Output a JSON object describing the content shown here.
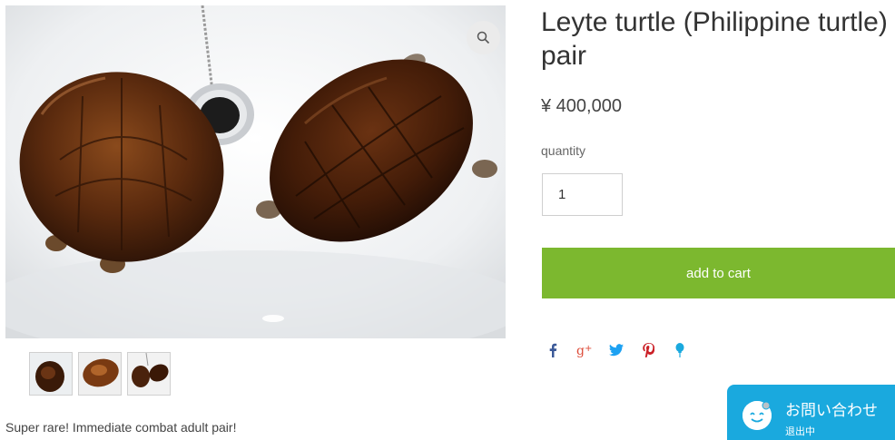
{
  "product": {
    "title": "Leyte turtle (Philippine turtle) pair",
    "price": "¥ 400,000",
    "quantity_label": "quantity",
    "quantity_value": "1",
    "add_to_cart_label": "add to cart",
    "description": "Super rare! Immediate combat adult pair!"
  },
  "gallery": {
    "zoom_icon": "magnifier-icon",
    "thumbnails": [
      "thumbnail-1",
      "thumbnail-2",
      "thumbnail-3"
    ]
  },
  "share": {
    "icons": [
      "facebook-icon",
      "google-plus-icon",
      "twitter-icon",
      "pinterest-icon",
      "pin-icon"
    ],
    "colors": {
      "facebook": "#3b5998",
      "google_plus": "#dd4b39",
      "twitter": "#1da1f2",
      "pinterest": "#cb2027",
      "pin": "#1aa9de"
    }
  },
  "chat": {
    "title": "お問い合わせ",
    "status": "退出中"
  },
  "colors": {
    "cart_button": "#7cb82f",
    "chat_widget": "#1aa9de"
  }
}
